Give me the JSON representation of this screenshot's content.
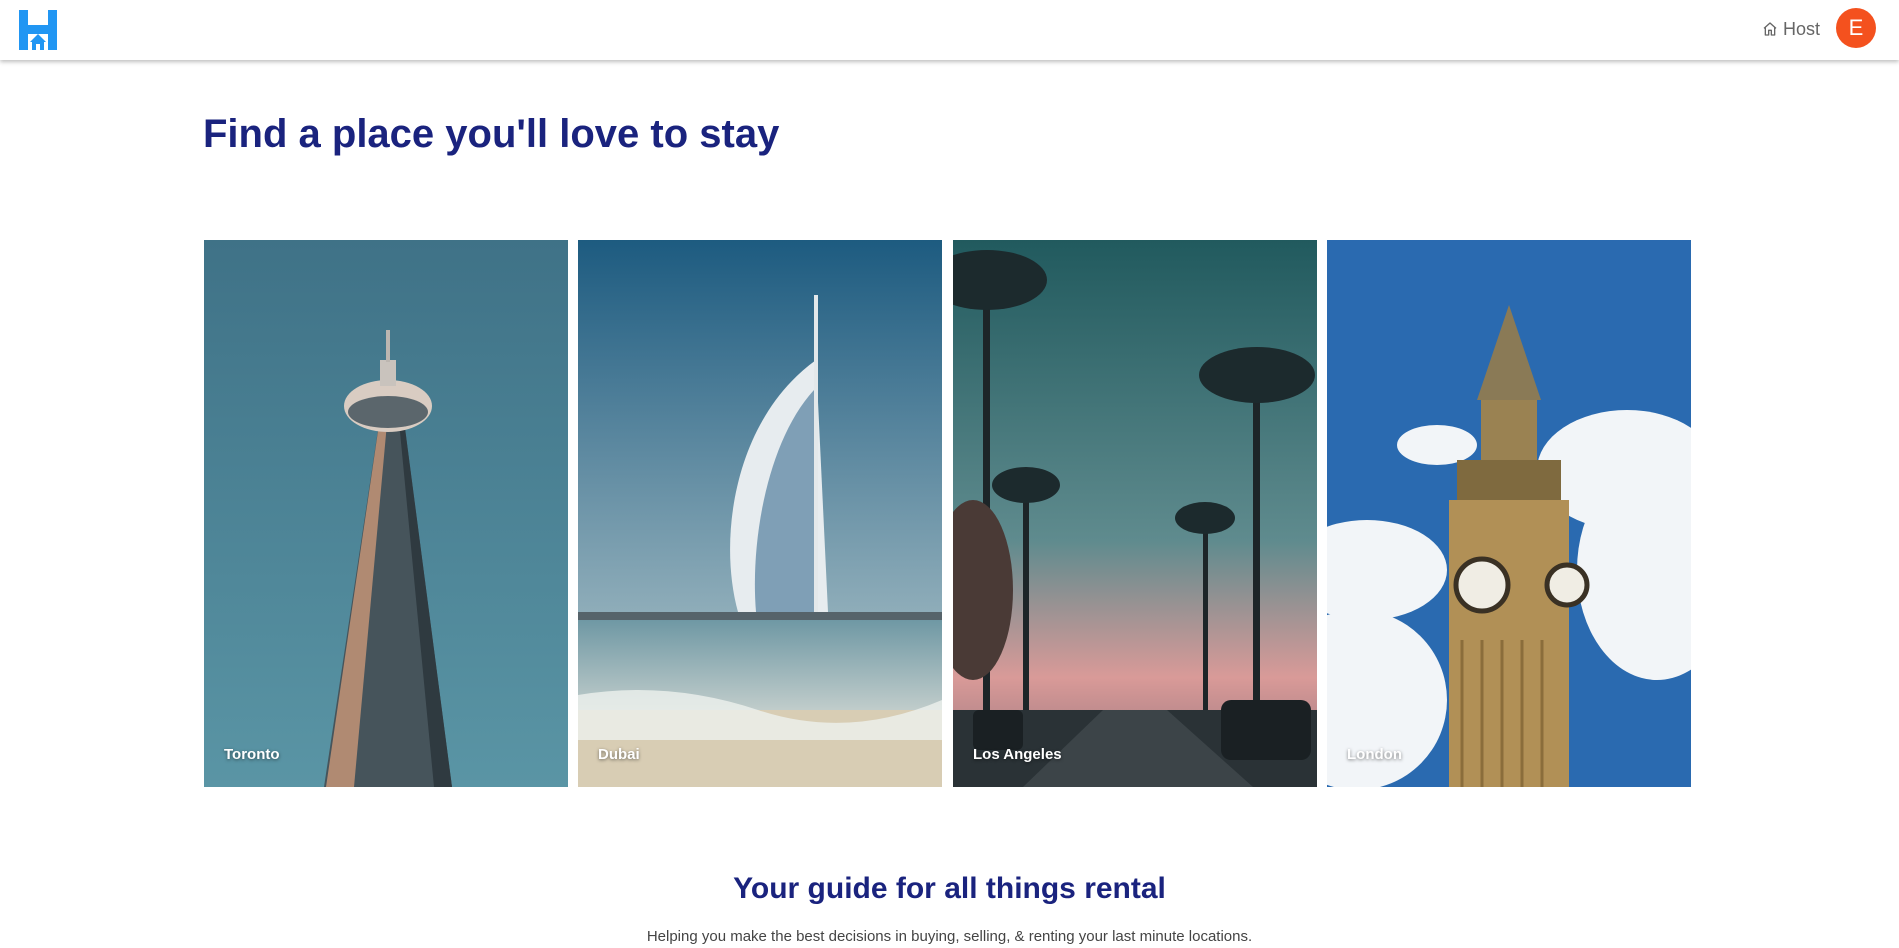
{
  "header": {
    "logo_icon": "house-h-logo",
    "host_icon": "home-icon",
    "host_label": "Host",
    "avatar_initial": "E",
    "brand_color": "#2196f3",
    "avatar_color": "#f4511e"
  },
  "hero": {
    "title": "Find a place you'll love to stay"
  },
  "cities": [
    {
      "name": "Toronto"
    },
    {
      "name": "Dubai"
    },
    {
      "name": "Los Angeles"
    },
    {
      "name": "London"
    }
  ],
  "guide": {
    "title": "Your guide for all things rental",
    "subtitle": "Helping you make the best decisions in buying, selling, & renting your last minute locations."
  },
  "colors": {
    "heading": "#1a237e"
  }
}
